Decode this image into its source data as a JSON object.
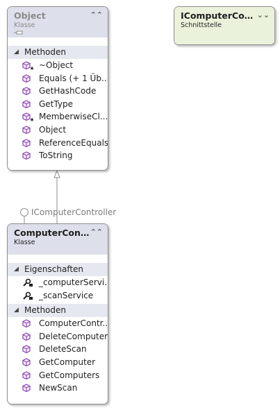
{
  "object_class": {
    "title": "Object",
    "kind": "Klasse",
    "section_methods": "Methoden",
    "methods": [
      {
        "name": "~Object",
        "icon": "protected-method-icon"
      },
      {
        "name": "Equals (+ 1 Üb...",
        "icon": "method-icon"
      },
      {
        "name": "GetHashCode",
        "icon": "method-icon"
      },
      {
        "name": "GetType",
        "icon": "method-icon"
      },
      {
        "name": "MemberwiseCl...",
        "icon": "protected-method-icon"
      },
      {
        "name": "Object",
        "icon": "method-icon"
      },
      {
        "name": "ReferenceEquals",
        "icon": "method-icon"
      },
      {
        "name": "ToString",
        "icon": "method-icon"
      }
    ]
  },
  "interface_box": {
    "title": "IComputerContr...",
    "kind": "Schnittstelle"
  },
  "lollipop_label": "IComputerController",
  "computer_class": {
    "title": "ComputerContr...",
    "kind": "Klasse",
    "section_properties": "Eigenschaften",
    "properties": [
      {
        "name": "_computerServi...",
        "icon": "private-property-icon"
      },
      {
        "name": "_scanService",
        "icon": "private-property-icon"
      }
    ],
    "section_methods": "Methoden",
    "methods": [
      {
        "name": "ComputerContr...",
        "icon": "method-icon"
      },
      {
        "name": "DeleteComputer",
        "icon": "method-icon"
      },
      {
        "name": "DeleteScan",
        "icon": "method-icon"
      },
      {
        "name": "GetComputer",
        "icon": "method-icon"
      },
      {
        "name": "GetComputers",
        "icon": "method-icon"
      },
      {
        "name": "NewScan",
        "icon": "method-icon"
      }
    ]
  },
  "colors": {
    "class_header": "#dde0ea",
    "class_section": "#e6e8f0",
    "interface_header": "#ebf2dc",
    "method_icon": "#8b3fb3",
    "property_icon": "#1e1e1e",
    "connector": "#8e8e8e"
  }
}
